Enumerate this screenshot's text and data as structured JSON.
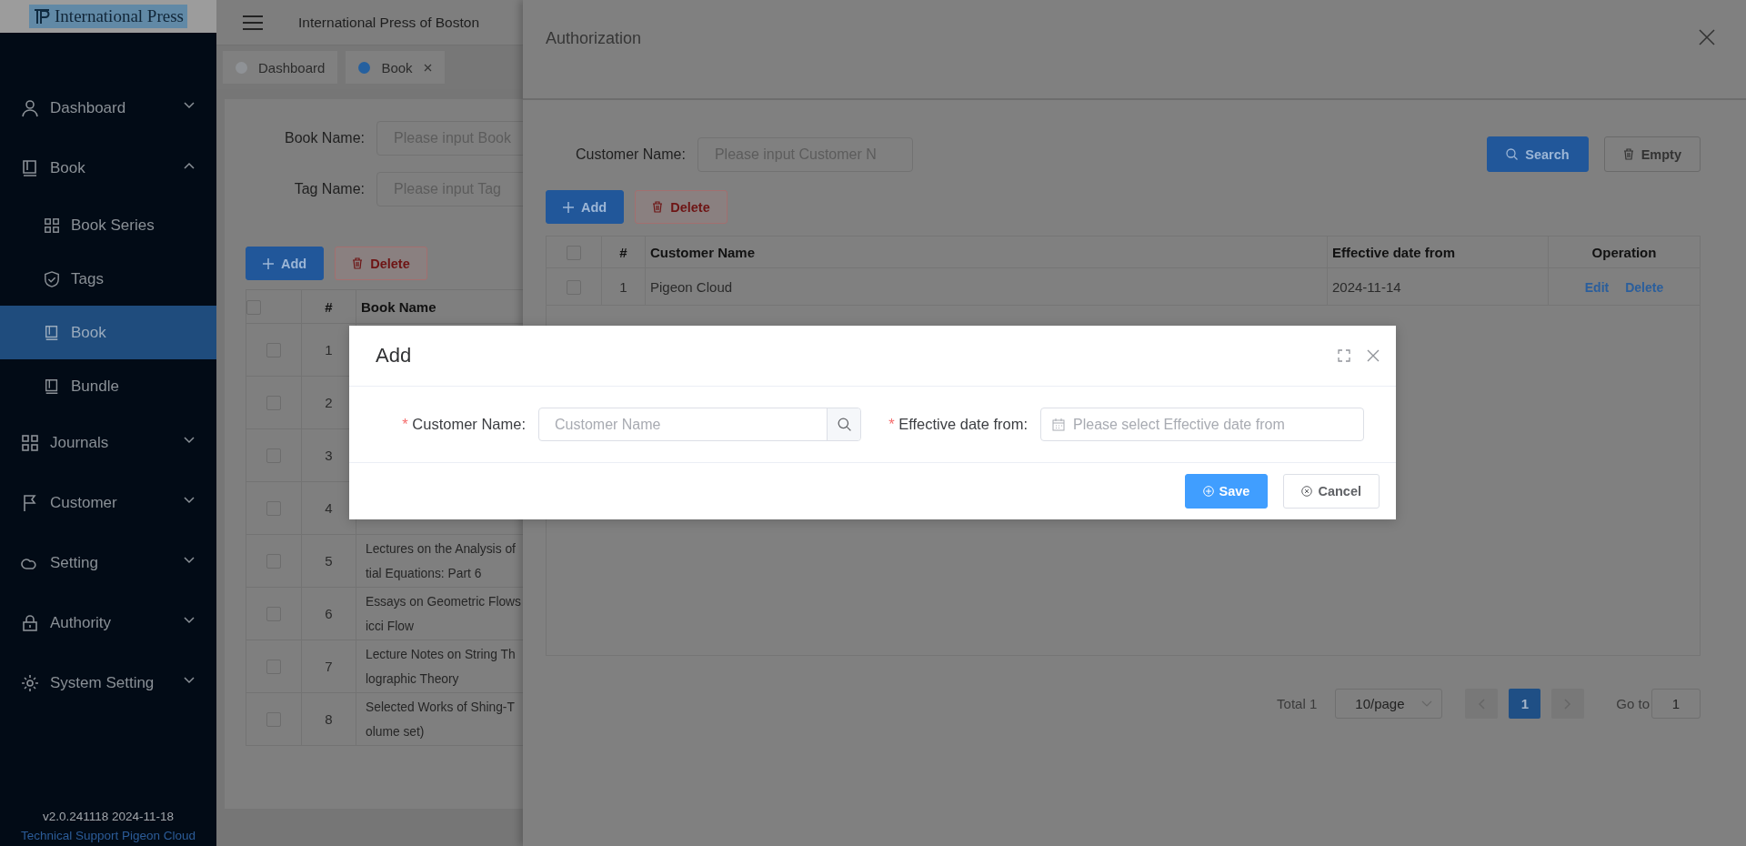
{
  "logo": {
    "text": "International Press"
  },
  "sidebar": {
    "items": [
      {
        "label": "Dashboard",
        "expanded": false,
        "selected": false
      },
      {
        "label": "Book",
        "expanded": true,
        "selected": false,
        "children": [
          {
            "label": "Book Series",
            "selected": false
          },
          {
            "label": "Tags",
            "selected": false
          },
          {
            "label": "Book",
            "selected": true
          },
          {
            "label": "Bundle",
            "selected": false
          }
        ]
      },
      {
        "label": "Journals",
        "expanded": false,
        "selected": false
      },
      {
        "label": "Customer",
        "expanded": false,
        "selected": false
      },
      {
        "label": "Setting",
        "expanded": false,
        "selected": false
      },
      {
        "label": "Authority",
        "expanded": false,
        "selected": false
      },
      {
        "label": "System Setting",
        "expanded": false,
        "selected": false
      }
    ],
    "footer": {
      "version": "v2.0.241118 2024-11-18",
      "support": "Technical Support Pigeon Cloud"
    }
  },
  "header": {
    "title": "International Press of Boston"
  },
  "tabs": [
    {
      "label": "Dashboard",
      "selected": false,
      "closable": false
    },
    {
      "label": "Book",
      "selected": true,
      "closable": true
    }
  ],
  "filters": [
    {
      "label": "Book Name:",
      "placeholder": "Please input Book"
    },
    {
      "label": "Tag Name:",
      "placeholder": "Please input Tag"
    }
  ],
  "actions": [
    {
      "label": "Add",
      "kind": "add"
    },
    {
      "label": "Delete",
      "kind": "delete"
    }
  ],
  "book_table": {
    "columns": [
      "#",
      "Book Name"
    ],
    "header_checked": false,
    "rows": [
      {
        "index": "1",
        "checked": false
      },
      {
        "index": "2",
        "checked": false
      },
      {
        "index": "3",
        "checked": false
      },
      {
        "index": "4",
        "checked": false
      },
      {
        "index": "5",
        "checked": false,
        "book_name": [
          "Lectures on the Analysis of",
          "tial Equations: Part 6"
        ]
      },
      {
        "index": "6",
        "checked": false,
        "book_name": [
          "Essays on Geometric Flows",
          "icci Flow"
        ]
      },
      {
        "index": "7",
        "checked": false,
        "book_name": [
          "Lecture Notes on String Th",
          "lographic Theory"
        ]
      },
      {
        "index": "8",
        "checked": false,
        "book_name": [
          "Selected Works of Shing-T",
          "olume set)"
        ]
      }
    ]
  },
  "drawer": {
    "title": "Authorization",
    "filter": {
      "label": "Customer Name:",
      "placeholder": "Please input Customer N"
    },
    "search_buttons": [
      {
        "label": "Search",
        "kind": "search"
      },
      {
        "label": "Empty",
        "kind": "empty"
      }
    ],
    "actions": [
      {
        "label": "Add",
        "kind": "add"
      },
      {
        "label": "Delete",
        "kind": "delete"
      }
    ],
    "table": {
      "columns": [
        "#",
        "Customer Name",
        "Effective date from",
        "Operation"
      ],
      "header_checked": false,
      "rows": [
        {
          "index": "1",
          "checked": false,
          "customer_name": "Pigeon Cloud",
          "effective_date": "2024-11-14",
          "operations": [
            "Edit",
            "Delete"
          ]
        }
      ]
    },
    "pagination": {
      "total": "Total 1",
      "page_size": "10/page",
      "pages": [
        {
          "label": "1",
          "selected": true
        }
      ],
      "goto_label": "Go to",
      "goto_value": "1"
    }
  },
  "modal": {
    "title": "Add",
    "fields": [
      {
        "label": "Customer Name:",
        "required_mark": "*",
        "placeholder": "Customer Name",
        "kind": "search"
      },
      {
        "label": "Effective date from:",
        "required_mark": "*",
        "placeholder": "Please select Effective date from",
        "kind": "date"
      }
    ],
    "buttons": [
      {
        "label": "Save",
        "kind": "primary"
      },
      {
        "label": "Cancel",
        "kind": "default"
      }
    ]
  }
}
